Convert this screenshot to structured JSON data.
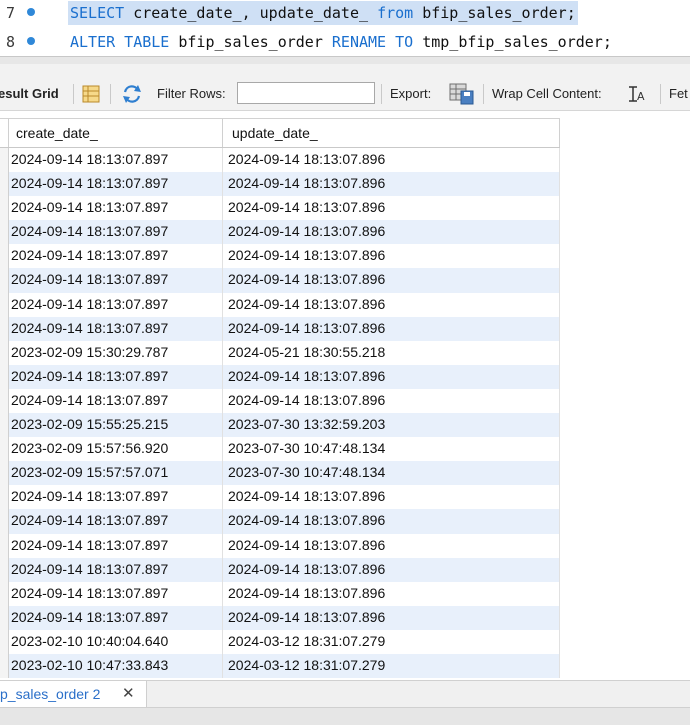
{
  "editor": {
    "lines": [
      {
        "number": "7",
        "selected": true,
        "tokens": [
          {
            "text": "SELECT",
            "kw": true
          },
          {
            "text": " create_date_, update_date_ ",
            "kw": false
          },
          {
            "text": "from",
            "kw": true
          },
          {
            "text": " bfip_sales_order;",
            "kw": false
          }
        ]
      },
      {
        "number": "8",
        "selected": false,
        "tokens": [
          {
            "text": "ALTER TABLE",
            "kw": true
          },
          {
            "text": " bfip_sales_order ",
            "kw": false
          },
          {
            "text": "RENAME TO",
            "kw": true
          },
          {
            "text": " tmp_bfip_sales_order;",
            "kw": false
          }
        ]
      }
    ]
  },
  "toolbar": {
    "result_grid_label": "esult Grid",
    "filter_rows_label": "Filter Rows:",
    "filter_rows_value": "",
    "export_label": "Export:",
    "wrap_label": "Wrap Cell Content:",
    "fetch_label": "Fet"
  },
  "grid": {
    "columns": [
      "create_date_",
      "update_date_"
    ],
    "rows": [
      [
        "2024-09-14 18:13:07.897",
        "2024-09-14 18:13:07.896"
      ],
      [
        "2024-09-14 18:13:07.897",
        "2024-09-14 18:13:07.896"
      ],
      [
        "2024-09-14 18:13:07.897",
        "2024-09-14 18:13:07.896"
      ],
      [
        "2024-09-14 18:13:07.897",
        "2024-09-14 18:13:07.896"
      ],
      [
        "2024-09-14 18:13:07.897",
        "2024-09-14 18:13:07.896"
      ],
      [
        "2024-09-14 18:13:07.897",
        "2024-09-14 18:13:07.896"
      ],
      [
        "2024-09-14 18:13:07.897",
        "2024-09-14 18:13:07.896"
      ],
      [
        "2024-09-14 18:13:07.897",
        "2024-09-14 18:13:07.896"
      ],
      [
        "2023-02-09 15:30:29.787",
        "2024-05-21 18:30:55.218"
      ],
      [
        "2024-09-14 18:13:07.897",
        "2024-09-14 18:13:07.896"
      ],
      [
        "2024-09-14 18:13:07.897",
        "2024-09-14 18:13:07.896"
      ],
      [
        "2023-02-09 15:55:25.215",
        "2023-07-30 13:32:59.203"
      ],
      [
        "2023-02-09 15:57:56.920",
        "2023-07-30 10:47:48.134"
      ],
      [
        "2023-02-09 15:57:57.071",
        "2023-07-30 10:47:48.134"
      ],
      [
        "2024-09-14 18:13:07.897",
        "2024-09-14 18:13:07.896"
      ],
      [
        "2024-09-14 18:13:07.897",
        "2024-09-14 18:13:07.896"
      ],
      [
        "2024-09-14 18:13:07.897",
        "2024-09-14 18:13:07.896"
      ],
      [
        "2024-09-14 18:13:07.897",
        "2024-09-14 18:13:07.896"
      ],
      [
        "2024-09-14 18:13:07.897",
        "2024-09-14 18:13:07.896"
      ],
      [
        "2024-09-14 18:13:07.897",
        "2024-09-14 18:13:07.896"
      ],
      [
        "2023-02-10 10:40:04.640",
        "2024-03-12 18:31:07.279"
      ],
      [
        "2023-02-10 10:47:33.843",
        "2024-03-12 18:31:07.279"
      ]
    ]
  },
  "tabs": {
    "active_label": "p_sales_order 2",
    "close_glyph": "✕"
  },
  "colors": {
    "keyword": "#1a6fce",
    "selection": "#cfe0f5",
    "row_alt": "#e8f0fb",
    "tab_text": "#2a6fc9"
  },
  "icons": [
    "breakpoint-dot-icon",
    "grid-form-icon",
    "refresh-icon",
    "export-file-icon",
    "wrap-text-icon",
    "close-icon"
  ]
}
